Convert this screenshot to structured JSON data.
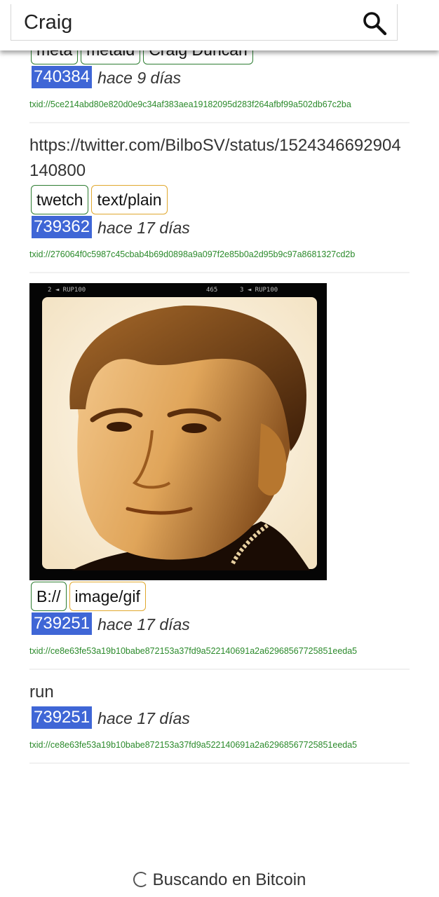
{
  "search": {
    "value": "Craig",
    "icon": "search-icon"
  },
  "colors": {
    "block_badge": "#3f66d6",
    "txid": "#2b8a2b",
    "tag_border": "#2e7d32",
    "mime_border": "#e0a82e"
  },
  "items": [
    {
      "tags": [
        "meta",
        "metaid",
        "Craig Duncan"
      ],
      "block": "740384",
      "ago": "hace 9 días",
      "txid": "txid://5ce214abd80e820d0e9c34af383aea19182095d283f264afbf99a502db67c2ba"
    },
    {
      "text": "https://twitter.com/BilboSV/status/1524346692904140800",
      "tags": [
        "twetch"
      ],
      "mime": "text/plain",
      "block": "739362",
      "ago": "hace 17 días",
      "txid": "txid://276064f0c5987c45cbab4b69d0898a9a097f2e85b0a2d95b9c97a8681327cd2b"
    },
    {
      "image": {
        "frame_text_left": "2 ◄ RUP100",
        "frame_text_mid": "465",
        "frame_text_right": "3 ◄ RUP100"
      },
      "tags": [
        "B://"
      ],
      "mime": "image/gif",
      "block": "739251",
      "ago": "hace 17 días",
      "txid": "txid://ce8e63fe53a19b10babe872153a37fd9a522140691a2a62968567725851eeda5"
    },
    {
      "text": "run",
      "block": "739251",
      "ago": "hace 17 días",
      "txid": "txid://ce8e63fe53a19b10babe872153a37fd9a522140691a2a62968567725851eeda5"
    }
  ],
  "status": {
    "loading": "Buscando en Bitcoin"
  }
}
